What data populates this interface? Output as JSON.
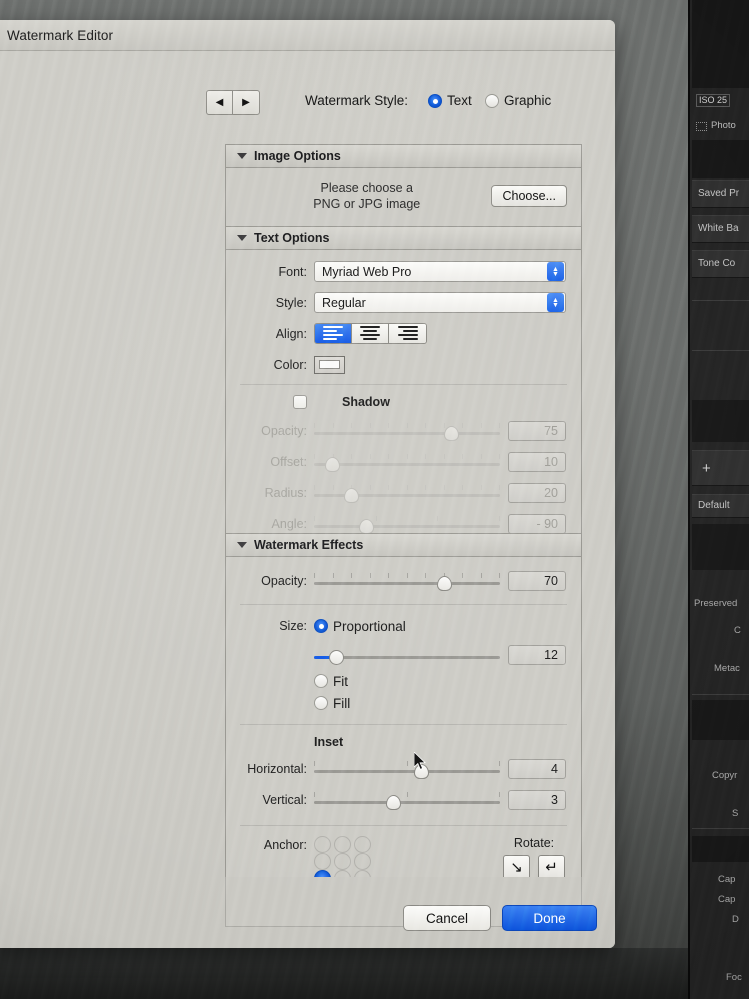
{
  "window": {
    "title": "Watermark Editor"
  },
  "toolbar": {
    "prev_icon": "◀",
    "next_icon": "▶",
    "style_label": "Watermark Style:",
    "style_options": [
      "Text",
      "Graphic"
    ],
    "style_selected": "Text"
  },
  "image_options": {
    "title": "Image Options",
    "message_line1": "Please choose a",
    "message_line2": "PNG or JPG image",
    "choose_button": "Choose..."
  },
  "text_options": {
    "title": "Text Options",
    "font_label": "Font:",
    "font_value": "Myriad Web Pro",
    "style_label": "Style:",
    "style_value": "Regular",
    "align_label": "Align:",
    "align_options": [
      "left",
      "center",
      "right"
    ],
    "align_selected": "left",
    "color_label": "Color:",
    "color_value": "#fbfbfa",
    "shadow": {
      "label": "Shadow",
      "enabled": false,
      "rows": [
        {
          "label": "Opacity:",
          "value": "75",
          "pct": 74
        },
        {
          "label": "Offset:",
          "value": "10",
          "pct": 10
        },
        {
          "label": "Radius:",
          "value": "20",
          "pct": 20
        },
        {
          "label": "Angle:",
          "value": "- 90",
          "pct": 28
        }
      ]
    }
  },
  "watermark_effects": {
    "title": "Watermark Effects",
    "opacity": {
      "label": "Opacity:",
      "value": "70",
      "pct": 70
    },
    "size": {
      "label": "Size:",
      "options": [
        "Proportional",
        "Fit",
        "Fill"
      ],
      "selected": "Proportional",
      "value": "12",
      "pct": 12
    },
    "inset": {
      "label": "Inset",
      "horizontal": {
        "label": "Horizontal:",
        "value": "4",
        "pct": 58
      },
      "vertical": {
        "label": "Vertical:",
        "value": "3",
        "pct": 43
      }
    },
    "anchor": {
      "label": "Anchor:",
      "selected_index": 6
    },
    "rotate": {
      "label": "Rotate:",
      "left_icon": "↘",
      "right_icon": "↵"
    }
  },
  "footer": {
    "cancel_label": "Cancel",
    "done_label": "Done"
  },
  "lightroom_panel": {
    "iso_badge": "ISO 25",
    "photo_label": "Photo",
    "bars": [
      "Saved Pr",
      "White Ba",
      "Tone Co"
    ],
    "plus_icon": "+",
    "default_label": "Default",
    "labels": [
      "Preserved",
      "C",
      "Metac",
      "Copyr",
      "S",
      "Cap",
      "Cap",
      "D",
      "Foc"
    ]
  },
  "colors": {
    "accent_blue": "#1159e6",
    "dialog_bg": "#cdccc6",
    "panel_dark": "#232323"
  }
}
